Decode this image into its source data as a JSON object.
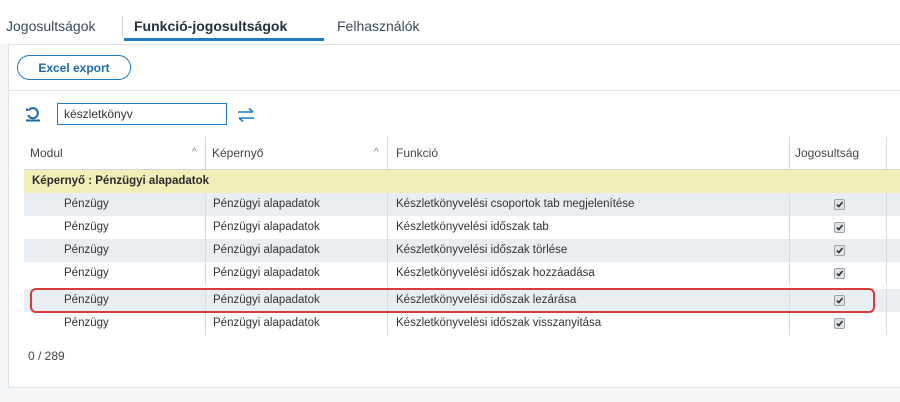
{
  "tabs": [
    {
      "label": "Jogosultságok",
      "active": false
    },
    {
      "label": "Funkció-jogosultságok",
      "active": true
    },
    {
      "label": "Felhasználók",
      "active": false
    }
  ],
  "toolbar": {
    "export_label": "Excel export"
  },
  "search": {
    "value": "készletkönyv"
  },
  "icons": {
    "refresh": "refresh-icon",
    "swap": "swap-arrows-icon",
    "sort": "sort-up-icon",
    "check": "check-icon"
  },
  "table": {
    "columns": [
      "Modul",
      "Képernyő",
      "Funkció",
      "Jogosultság"
    ],
    "sort_indicator": "^",
    "group": "Képernyő :  Pénzügyi alapadatok",
    "rows": [
      {
        "modul": "Pénzügy",
        "kepernyo": "Pénzügyi alapadatok",
        "funkcio": "Készletkönyvelési csoportok tab megjelenítése",
        "jogosultsag": true
      },
      {
        "modul": "Pénzügy",
        "kepernyo": "Pénzügyi alapadatok",
        "funkcio": "Készletkönyvelési időszak tab",
        "jogosultsag": true
      },
      {
        "modul": "Pénzügy",
        "kepernyo": "Pénzügyi alapadatok",
        "funkcio": "Készletkönyvelési időszak törlése",
        "jogosultsag": true
      },
      {
        "modul": "Pénzügy",
        "kepernyo": "Pénzügyi alapadatok",
        "funkcio": "Készletkönyvelési időszak hozzáadása",
        "jogosultsag": true
      },
      {
        "modul": "Pénzügy",
        "kepernyo": "Pénzügyi alapadatok",
        "funkcio": "Készletkönyvelési időszak lezárása",
        "jogosultsag": true,
        "highlighted": true
      },
      {
        "modul": "Pénzügy",
        "kepernyo": "Pénzügyi alapadatok",
        "funkcio": "Készletkönyvelési időszak visszanyitása",
        "jogosultsag": true
      }
    ]
  },
  "pager": {
    "text": "0  /  289"
  },
  "colors": {
    "accent": "#1e7bc4",
    "group_bg": "#f2eeb8",
    "highlight": "#d93a3a",
    "row_alt": "#e9eef3"
  }
}
